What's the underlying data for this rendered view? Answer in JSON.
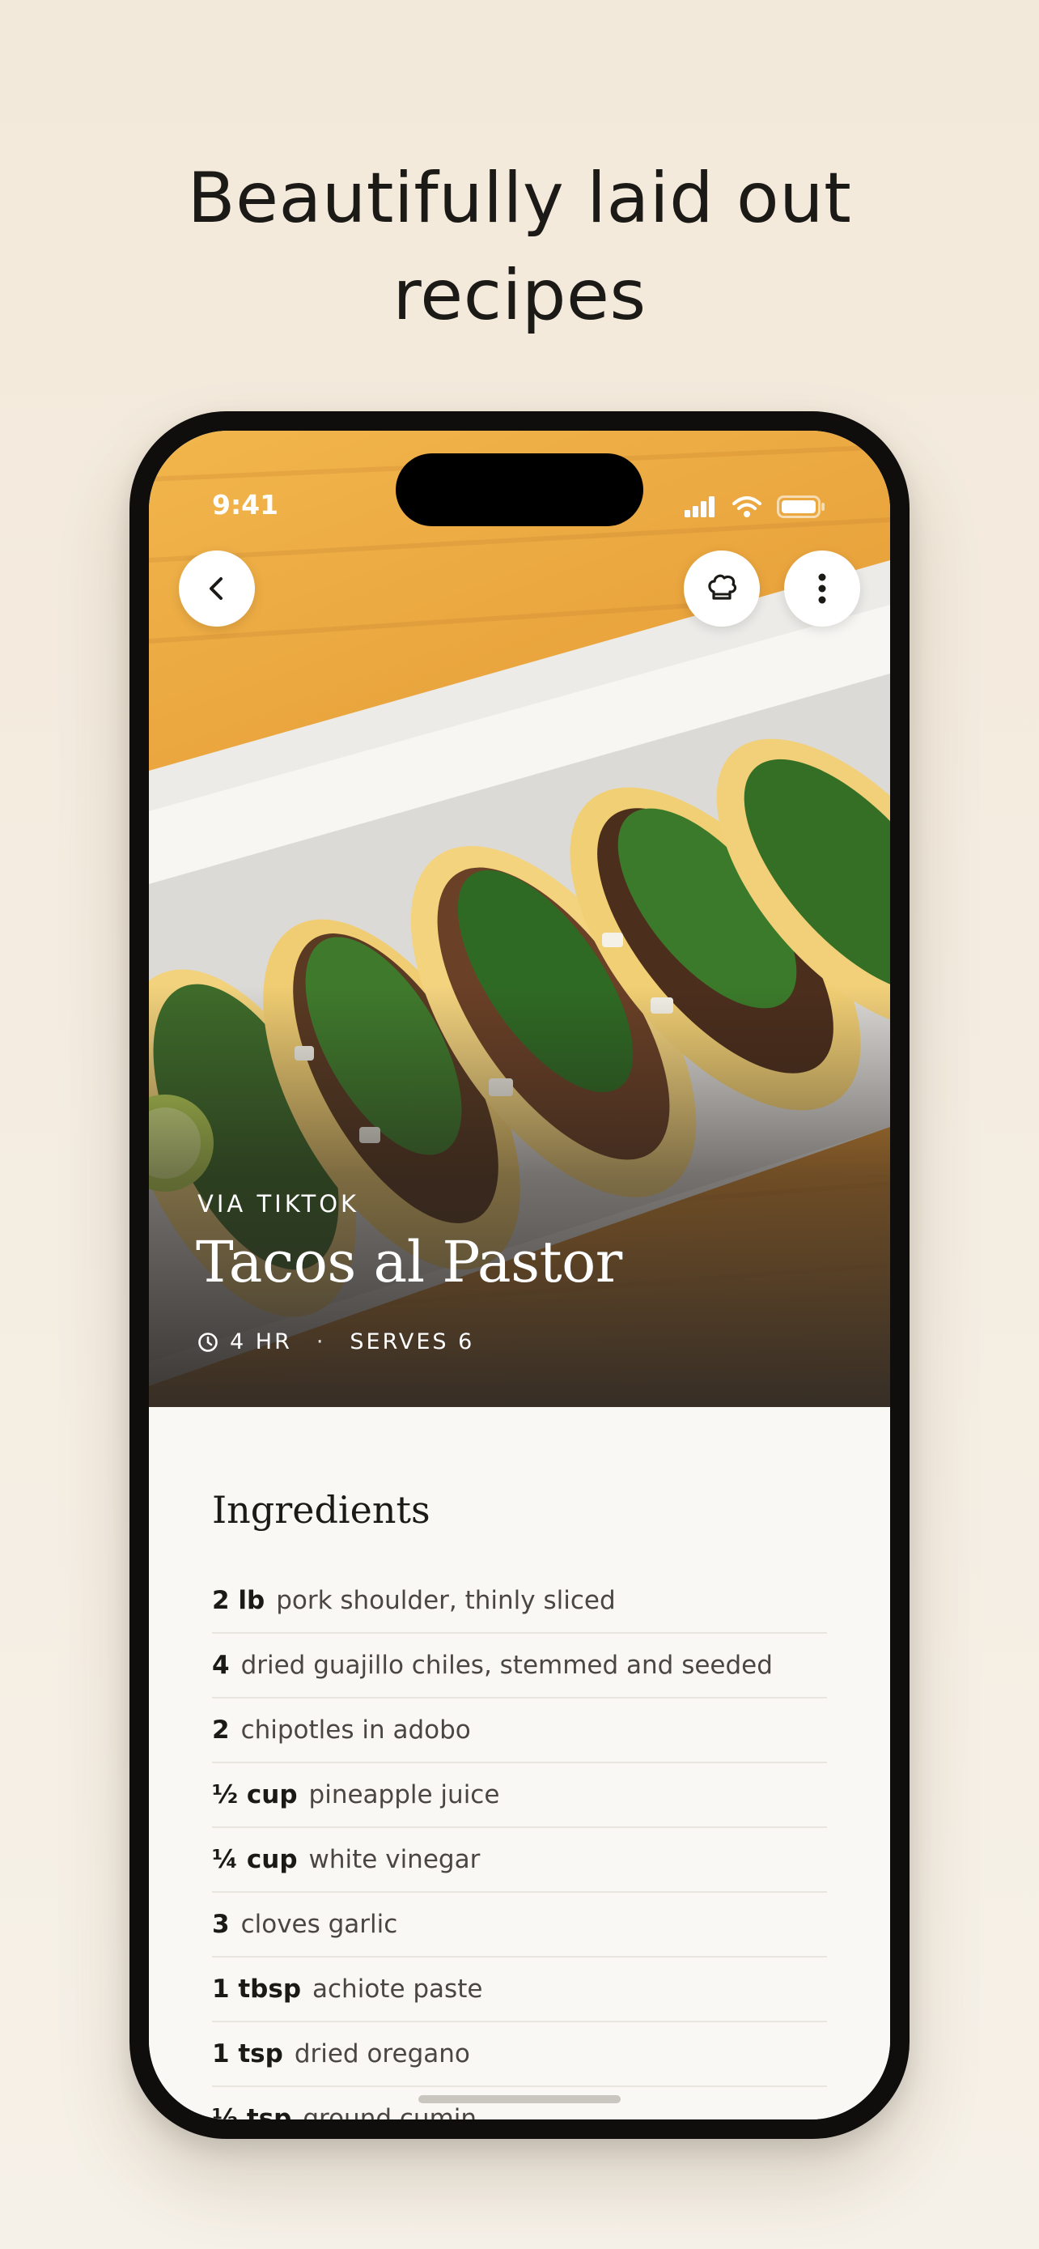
{
  "headline": {
    "line1": "Beautifully laid out",
    "line2": "recipes"
  },
  "status_bar": {
    "time": "9:41"
  },
  "recipe": {
    "source": "VIA TIKTOK",
    "title": "Tacos al Pastor",
    "time": "4 HR",
    "separator": "·",
    "serves": "SERVES 6"
  },
  "icons": {
    "back": "chevron-left-icon",
    "chef": "chef-hat-icon",
    "more": "more-vertical-icon",
    "clock": "clock-icon"
  },
  "ingredients": {
    "heading": "Ingredients",
    "items": [
      {
        "qty": "2 lb",
        "name": "pork shoulder, thinly sliced"
      },
      {
        "qty": "4",
        "name": "dried guajillo chiles, stemmed and seeded"
      },
      {
        "qty": "2",
        "name": "chipotles in adobo"
      },
      {
        "qty": "½ cup",
        "name": "pineapple juice"
      },
      {
        "qty": "¼ cup",
        "name": "white vinegar"
      },
      {
        "qty": "3",
        "name": "cloves garlic"
      },
      {
        "qty": "1 tbsp",
        "name": "achiote paste"
      },
      {
        "qty": "1 tsp",
        "name": "dried oregano"
      },
      {
        "qty": "½ tsp",
        "name": "ground cumin"
      }
    ]
  },
  "colors": {
    "background": "#f3e9da",
    "text": "#1c1a17",
    "phone_frame": "#0f0e0d"
  }
}
